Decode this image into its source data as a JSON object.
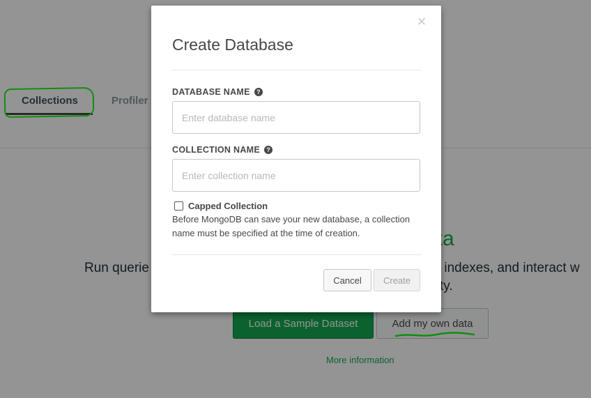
{
  "background": {
    "tabs": [
      {
        "label": "Collections",
        "active": true
      },
      {
        "label": "Profiler",
        "active": false
      }
    ],
    "heading_visible": "ata",
    "body_text_left": "Run querie",
    "body_text_right_1": "es indexes, and interact w",
    "body_text_right_2": "ality.",
    "primary_button": "Load a Sample Dataset",
    "secondary_button": "Add my own data",
    "more_info_link": "More information"
  },
  "modal": {
    "title": "Create Database",
    "close_icon": "×",
    "database_name": {
      "label": "DATABASE NAME",
      "placeholder": "Enter database name",
      "value": ""
    },
    "collection_name": {
      "label": "COLLECTION NAME",
      "placeholder": "Enter collection name",
      "value": ""
    },
    "help_icon": "?",
    "capped_collection": {
      "label": "Capped Collection",
      "checked": false
    },
    "info_text": "Before MongoDB can save your new database, a collection name must be specified at the time of creation.",
    "cancel_button": "Cancel",
    "create_button": "Create"
  },
  "colors": {
    "brand_green": "#13aa52",
    "annotation_green": "#1cf51c",
    "overlay": "rgba(0,0,0,0.42)"
  }
}
